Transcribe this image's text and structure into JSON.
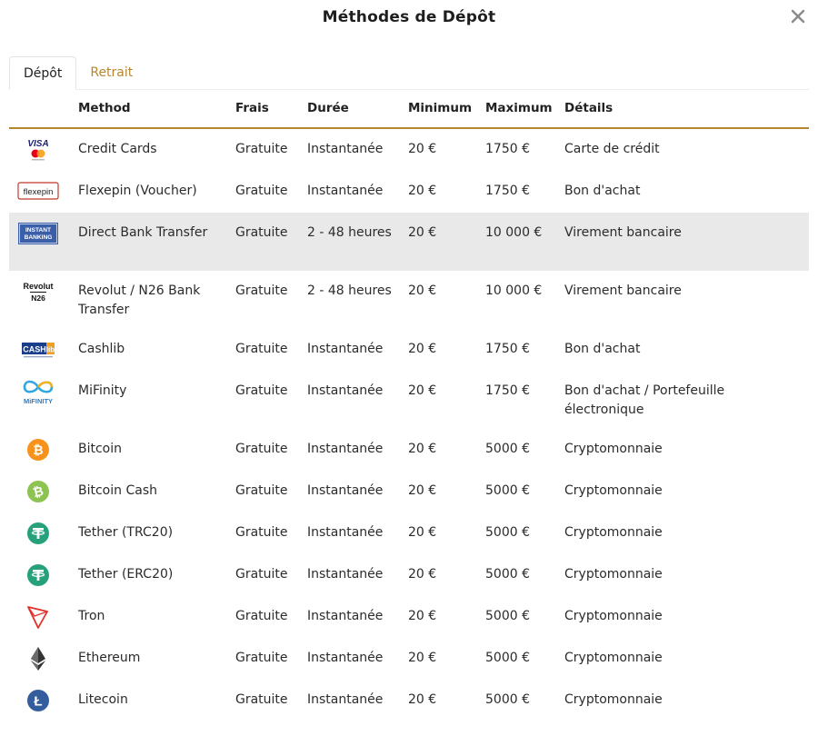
{
  "modal": {
    "title": "Méthodes de Dépôt"
  },
  "tabs": [
    {
      "label": "Dépôt"
    },
    {
      "label": "Retrait"
    }
  ],
  "headers": {
    "method": "Method",
    "frais": "Frais",
    "duree": "Durée",
    "minimum": "Minimum",
    "maximum": "Maximum",
    "details": "Détails"
  },
  "colors": {
    "accent": "#b5862e",
    "highlight_row": "#e9e9e9"
  },
  "rows": [
    {
      "icon": "visa-mastercard-icon",
      "method": "Credit Cards",
      "frais": "Gratuite",
      "duree": "Instantanée",
      "minimum": "20 €",
      "maximum": "1750 €",
      "details": "Carte de crédit",
      "logo_text": "VISA"
    },
    {
      "icon": "flexepin-icon",
      "method": "Flexepin (Voucher)",
      "frais": "Gratuite",
      "duree": "Instantanée",
      "minimum": "20 €",
      "maximum": "1750 €",
      "details": "Bon d'achat",
      "logo_text": "flexepin"
    },
    {
      "icon": "instant-banking-icon",
      "method": "Direct Bank Transfer",
      "frais": "Gratuite",
      "duree": "2 - 48 heures",
      "minimum": "20 €",
      "maximum": "10 000 €",
      "details": "Virement bancaire",
      "logo_text": "INSTANT BANKING"
    },
    {
      "icon": "revolut-n26-icon",
      "method": "Revolut / N26 Bank Transfer",
      "frais": "Gratuite",
      "duree": "2 - 48 heures",
      "minimum": "20 €",
      "maximum": "10 000 €",
      "details": "Virement bancaire",
      "logo_text": "Revolut N26"
    },
    {
      "icon": "cashlib-icon",
      "method": "Cashlib",
      "frais": "Gratuite",
      "duree": "Instantanée",
      "minimum": "20 €",
      "maximum": "1750 €",
      "details": "Bon d'achat",
      "logo_text": "CASHlib"
    },
    {
      "icon": "mifinity-icon",
      "method": "MiFinity",
      "frais": "Gratuite",
      "duree": "Instantanée",
      "minimum": "20 €",
      "maximum": "1750 €",
      "details": "Bon d'achat / Portefeuille électronique",
      "logo_text": "MiFINITY"
    },
    {
      "icon": "bitcoin-icon",
      "method": "Bitcoin",
      "frais": "Gratuite",
      "duree": "Instantanée",
      "minimum": "20 €",
      "maximum": "5000 €",
      "details": "Cryptomonnaie"
    },
    {
      "icon": "bitcoin-cash-icon",
      "method": "Bitcoin Cash",
      "frais": "Gratuite",
      "duree": "Instantanée",
      "minimum": "20 €",
      "maximum": "5000 €",
      "details": "Cryptomonnaie"
    },
    {
      "icon": "tether-trc20-icon",
      "method": "Tether (TRC20)",
      "frais": "Gratuite",
      "duree": "Instantanée",
      "minimum": "20 €",
      "maximum": "5000 €",
      "details": "Cryptomonnaie"
    },
    {
      "icon": "tether-erc20-icon",
      "method": "Tether (ERC20)",
      "frais": "Gratuite",
      "duree": "Instantanée",
      "minimum": "20 €",
      "maximum": "5000 €",
      "details": "Cryptomonnaie"
    },
    {
      "icon": "tron-icon",
      "method": "Tron",
      "frais": "Gratuite",
      "duree": "Instantanée",
      "minimum": "20 €",
      "maximum": "5000 €",
      "details": "Cryptomonnaie"
    },
    {
      "icon": "ethereum-icon",
      "method": "Ethereum",
      "frais": "Gratuite",
      "duree": "Instantanée",
      "minimum": "20 €",
      "maximum": "5000 €",
      "details": "Cryptomonnaie"
    },
    {
      "icon": "litecoin-icon",
      "method": "Litecoin",
      "frais": "Gratuite",
      "duree": "Instantanée",
      "minimum": "20 €",
      "maximum": "5000 €",
      "details": "Cryptomonnaie"
    }
  ]
}
